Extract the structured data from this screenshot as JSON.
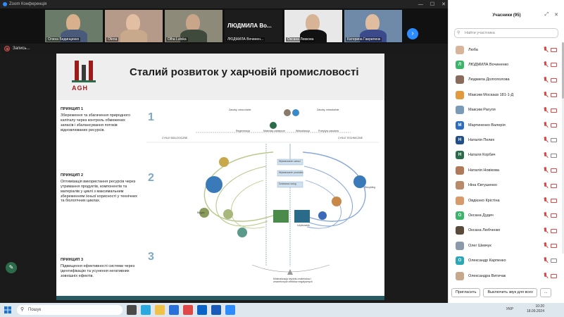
{
  "window": {
    "title": "Zoom Конференція"
  },
  "video_strip": {
    "tiles": [
      {
        "name": "Олена Бединценко",
        "face": "#d8b08c",
        "body": "#4a5a7a",
        "bg": "#6b7b6a"
      },
      {
        "name": "Olena",
        "face": "#e2bfa2",
        "body": "#c9a98b",
        "bg": "#b59a8a"
      },
      {
        "name": "Olha Lutska",
        "face": "#c9a58a",
        "body": "#3f4a3c",
        "bg": "#8d8a7a"
      },
      {
        "name": "ЛЮДМИЛА Вочинен...",
        "big": "ЛЮДМИЛА  Во..."
      },
      {
        "name": "Оксана Левкова",
        "face": "#d8b496",
        "body": "#111",
        "bg": "#e8e8e8"
      },
      {
        "name": "Катерина Гавриленк",
        "face": "#e0bd9f",
        "body": "#3a4a8a",
        "bg": "#6f8aa8"
      }
    ]
  },
  "recording": {
    "label": "Запись..."
  },
  "slide": {
    "logo_text": "AGH",
    "title": "Сталий розвиток у харчовій промисловості",
    "principles": [
      {
        "heading": "ПРИНЦИП 1",
        "text": "Збереження та збагачення природного капіталу через контроль обмежених запасів і збалансування потоків відновлюваних ресурсів."
      },
      {
        "heading": "ПРИНЦИП 2",
        "text": "Оптимізація використання ресурсів через утримання продуктів, компонентів та матеріалів у циклі з максимальним збереженням їхньої корисності у технічних та біологічних циклах."
      },
      {
        "heading": "ПРИНЦИП 3",
        "text": "Підвищення ефективності системи через ідентифікацію та усунення негативних зовнішніх ефектів."
      }
    ],
    "diagram_labels": {
      "cycle_bio": "CYKLE BIOLOGICZNE",
      "cycle_tech": "CYKLE TECHNICZNE",
      "top_left": "Zasoby, odna-nialne",
      "top_right": "Zasoby, mieszkalnie",
      "regeneration": "Regeneracja",
      "materials": "Materialy zastepcze",
      "virtualization": "Wirtualizacja",
      "flow": "Przeplyw zasobow",
      "manufacture": "Wytwarzanie czesci",
      "product": "Wytwarzanie produktu",
      "service": "Dostawca uslug",
      "recycling": "Recykling",
      "biogas": "Biogaz",
      "consumer": "Uzytkownik",
      "leakage": "Minimalizacja wycieku materialow i zewnetrznych efektow negatywnych",
      "num1": "1",
      "num2": "2",
      "num3": "3"
    }
  },
  "participants": {
    "header": "Учасники (95)",
    "search_placeholder": "Найти участника",
    "list": [
      {
        "name": "Люба",
        "color": "#d8b49a",
        "initial": "",
        "cam": "off"
      },
      {
        "name": "ЛЮДМИЛА Вочиненко",
        "color": "#3bb56a",
        "initial": "Л",
        "cam": "off"
      },
      {
        "name": "Людмила Долгополова",
        "color": "#8a6a5a",
        "initial": "",
        "cam": "off"
      },
      {
        "name": "Максим Москаєв 181-1-Д",
        "color": "#e39a3c",
        "initial": "",
        "cam": "off"
      },
      {
        "name": "Максим Рагуля",
        "color": "#7a9ab8",
        "initial": "",
        "cam": "off"
      },
      {
        "name": "Мартиненко Валерія",
        "color": "#2d6cbf",
        "initial": "М",
        "cam": "off"
      },
      {
        "name": "Наталія Пелих",
        "color": "#1f4e8a",
        "initial": "Н",
        "cam": "on"
      },
      {
        "name": "Наталя Корбич",
        "color": "#2b6b4a",
        "initial": "Н",
        "cam": "on"
      },
      {
        "name": "Наталія Новікова",
        "color": "#b07a5a",
        "initial": "",
        "cam": "off"
      },
      {
        "name": "Ніна Євтушенко",
        "color": "#b88a6a",
        "initial": "",
        "cam": "off"
      },
      {
        "name": "Овдієнко Крістіна",
        "color": "#d89a6a",
        "initial": "",
        "cam": "off"
      },
      {
        "name": "Оксана Дудич",
        "color": "#3bb56a",
        "initial": "О",
        "cam": "off"
      },
      {
        "name": "Оксана Любченко",
        "color": "#5a4a3a",
        "initial": "",
        "cam": "off"
      },
      {
        "name": "Олег Шевчук",
        "color": "#8a9aa8",
        "initial": "",
        "cam": "off"
      },
      {
        "name": "Олександр Карпенко",
        "color": "#2aa8b8",
        "initial": "О",
        "cam": "on"
      },
      {
        "name": "Олександра Витичак",
        "color": "#c8a88a",
        "initial": "",
        "cam": "off"
      }
    ],
    "invite_label": "Пригласить",
    "mute_all_label": "Выключить звук для всех",
    "more_label": "..."
  },
  "taskbar": {
    "search_text": "Пошук",
    "lang": "УКР",
    "time": "10:20",
    "date": "18.09.2024"
  }
}
